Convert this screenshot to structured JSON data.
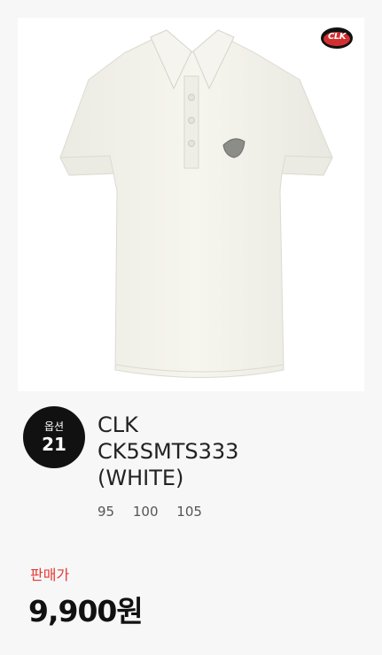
{
  "logo": {
    "text": "CLK"
  },
  "option": {
    "label": "옵션",
    "count": "21"
  },
  "product": {
    "brand": "CLK",
    "model": "CK5SMTS333",
    "color": "(WHITE)",
    "sizes": [
      "95",
      "100",
      "105"
    ]
  },
  "price": {
    "label": "판매가",
    "value": "9,900원"
  },
  "colors": {
    "background": "#f7f7f7",
    "image_bg": "#ffffff",
    "shirt": "#f4f2ea",
    "badge": "#111111",
    "price_label": "#e53935",
    "logo_red": "#d32f2f"
  }
}
